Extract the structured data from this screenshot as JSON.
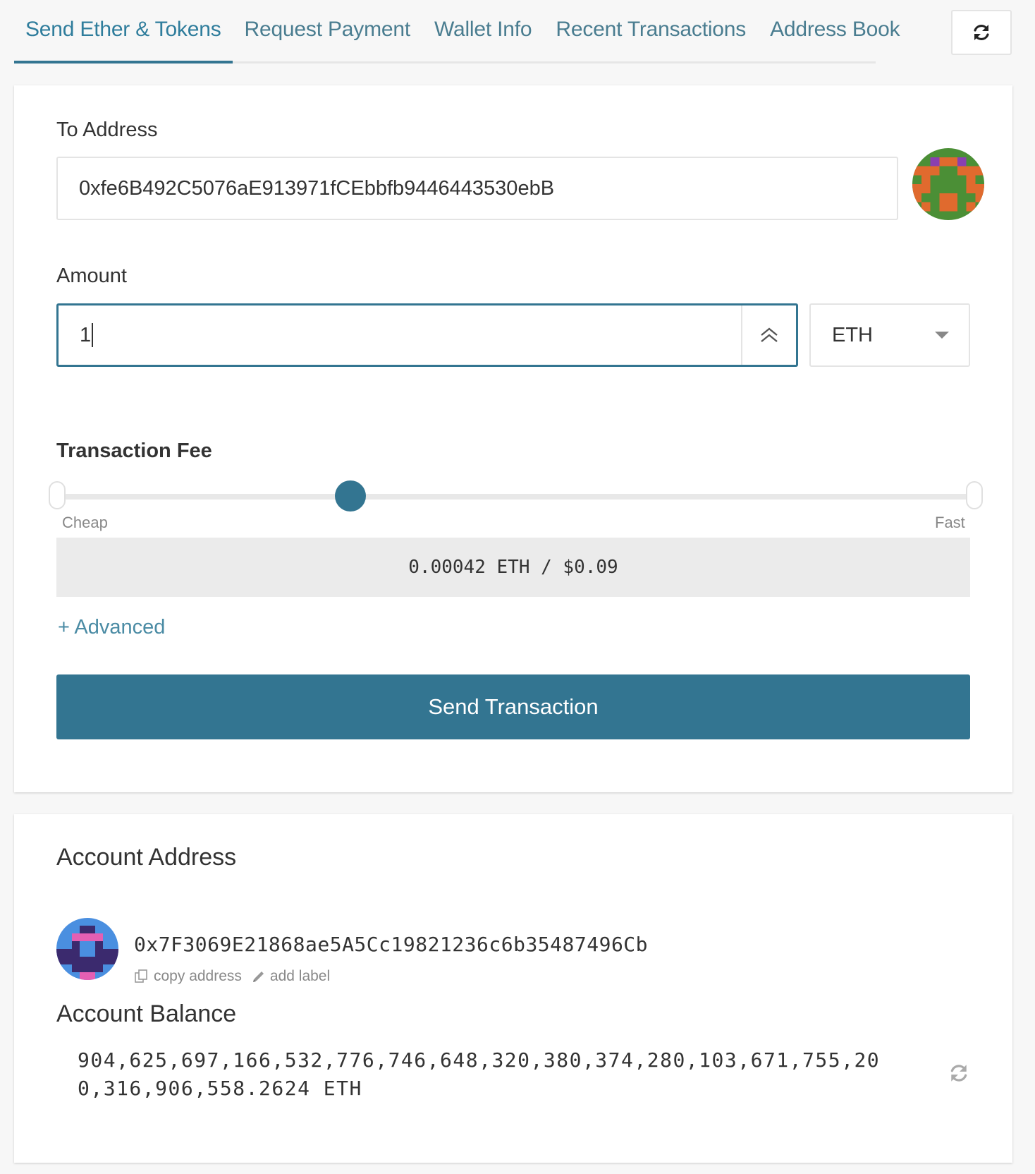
{
  "tabs": [
    {
      "label": "Send Ether & Tokens",
      "active": true
    },
    {
      "label": "Request Payment",
      "active": false
    },
    {
      "label": "Wallet Info",
      "active": false
    },
    {
      "label": "Recent Transactions",
      "active": false
    },
    {
      "label": "Address Book",
      "active": false
    }
  ],
  "top_refresh_icon": "refresh-icon",
  "send": {
    "to_label": "To Address",
    "to_value": "0xfe6B492C5076aE913971fCEbbfb9446443530ebB",
    "amount_label": "Amount",
    "amount_value": "1",
    "currency": "ETH",
    "fee_label": "Transaction Fee",
    "fee_level": 0.32,
    "fee_min_label": "Cheap",
    "fee_max_label": "Fast",
    "fee_display": "0.00042 ETH / $0.09",
    "advanced_label": "+ Advanced",
    "send_button": "Send Transaction"
  },
  "account": {
    "address_title": "Account Address",
    "address": "0x7F3069E21868ae5A5Cc19821236c6b35487496Cb",
    "copy_label": "copy address",
    "label_label": "add label",
    "balance_title": "Account Balance",
    "balance": "904,625,697,166,532,776,746,648,320,380,374,280,103,671,755,200,316,906,558.2624 ETH"
  },
  "colors": {
    "accent": "#337591",
    "link": "#4a8ba4"
  }
}
